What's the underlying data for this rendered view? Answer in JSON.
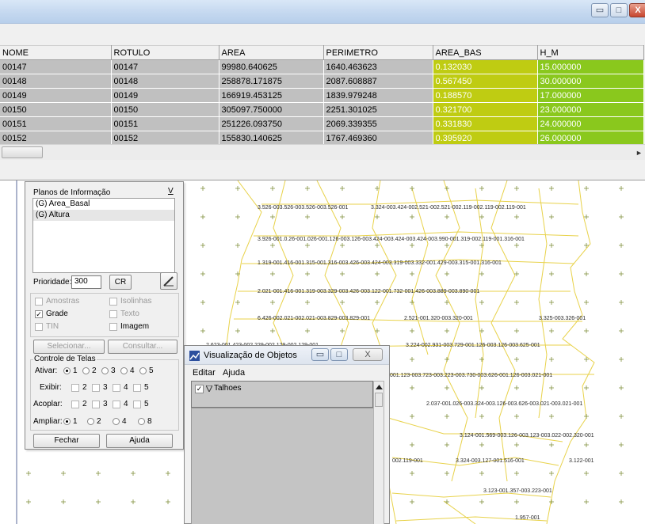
{
  "table_window": {
    "caption_buttons": {
      "minimize": "▭",
      "maximize": "□",
      "close": "X"
    },
    "columns": [
      "NOME",
      "ROTULO",
      "AREA",
      "PERIMETRO",
      "AREA_BAS",
      "H_M"
    ],
    "rows": [
      [
        "00147",
        "00147",
        "99980.640625",
        "1640.463623",
        "0.132030",
        "15.000000"
      ],
      [
        "00148",
        "00148",
        "258878.171875",
        "2087.608887",
        "0.567450",
        "30.000000"
      ],
      [
        "00149",
        "00149",
        "166919.453125",
        "1839.979248",
        "0.188570",
        "17.000000"
      ],
      [
        "00150",
        "00150",
        "305097.750000",
        "2251.301025",
        "0.321700",
        "23.000000"
      ],
      [
        "00151",
        "00151",
        "251226.093750",
        "2069.339355",
        "0.331830",
        "24.000000"
      ],
      [
        "00152",
        "00152",
        "155830.140625",
        "1767.469360",
        "0.395920",
        "26.000000"
      ]
    ],
    "scroll_arrow": "►",
    "colors": {
      "area_bas": "#bfcc12",
      "h_m": "#8ac81d",
      "row_bg": "#c0c0c0"
    }
  },
  "control_panel": {
    "planos_label": "Planos de Informação",
    "planos_btn": "V",
    "layers": [
      "(G) Area_Basal",
      "(G) Altura"
    ],
    "prioridade_label": "Prioridade:",
    "prioridade_value": "300",
    "cr_btn": "CR",
    "checks": {
      "amostras": "Amostras",
      "isolinhas": "Isolinhas",
      "grade": "Grade",
      "texto": "Texto",
      "tin": "TIN",
      "imagem": "Imagem"
    },
    "selecionar_btn": "Selecionar...",
    "consultar_btn": "Consultar...",
    "controle_label": "Controle de Telas",
    "ativar_label": "Ativar:",
    "exibir_label": "Exibir:",
    "acoplar_label": "Acoplar:",
    "ampliar_label": "Ampliar:",
    "nums5": [
      "1",
      "2",
      "3",
      "4",
      "5"
    ],
    "nums_ampliar": [
      "1",
      "2",
      "4",
      "8"
    ],
    "fechar_btn": "Fechar",
    "ajuda_btn": "Ajuda"
  },
  "vis_window": {
    "title": "Visualização de Objetos",
    "menu": [
      "Editar",
      "Ajuda"
    ],
    "item": "Talhoes",
    "caption_buttons": {
      "minimize": "▭",
      "maximize": "□",
      "close": "X"
    }
  },
  "map_labels": {
    "row1": "3.526-003.526-003.526-003.526-001",
    "row1b": "3.324-003.424-002.521-002.521-002.119-002.119-002.119-001",
    "row2": "3.926-001.0.26-001.026-001.126-003.126-003.424-003.424-003.424-003.990-001.319-002.119-001.316-001",
    "row3": "1.319-001.416-001.315-001.316-003.426-003.424-003.319-003.332-001.429-003.315-001.316-001",
    "row4": "2.021-001.416-001.319-003.329-003.426-003.122-001.732-001.426-003.889-003.890-001",
    "row5": "6.426-002.021-002.021-003.829-003.829-001",
    "row5b": "2.521-001.320-003.320-001",
    "row5c": "3.325-003.326-001",
    "row6": "2.623-001.423-002.229-002.129-002.129-001",
    "row6b": "3.224-002.931-003.729-001.126-003.126-003.625-001",
    "row7": "001.123-003.723-003.223-003.730-003.626-001.126-003.021-001",
    "row8": "2.037-001.026-003.324-003.126-003.626-003.021-003.021-001",
    "row9": "3.124-001.569-003.126-003.123-003.022-002.320-001",
    "row10": "002.119-001",
    "row10b": "3.324-003.127-001.516-001",
    "row10c": "3.122-001",
    "row11": "3.123-001.357-003.223-001",
    "row12": "1.957-001"
  }
}
